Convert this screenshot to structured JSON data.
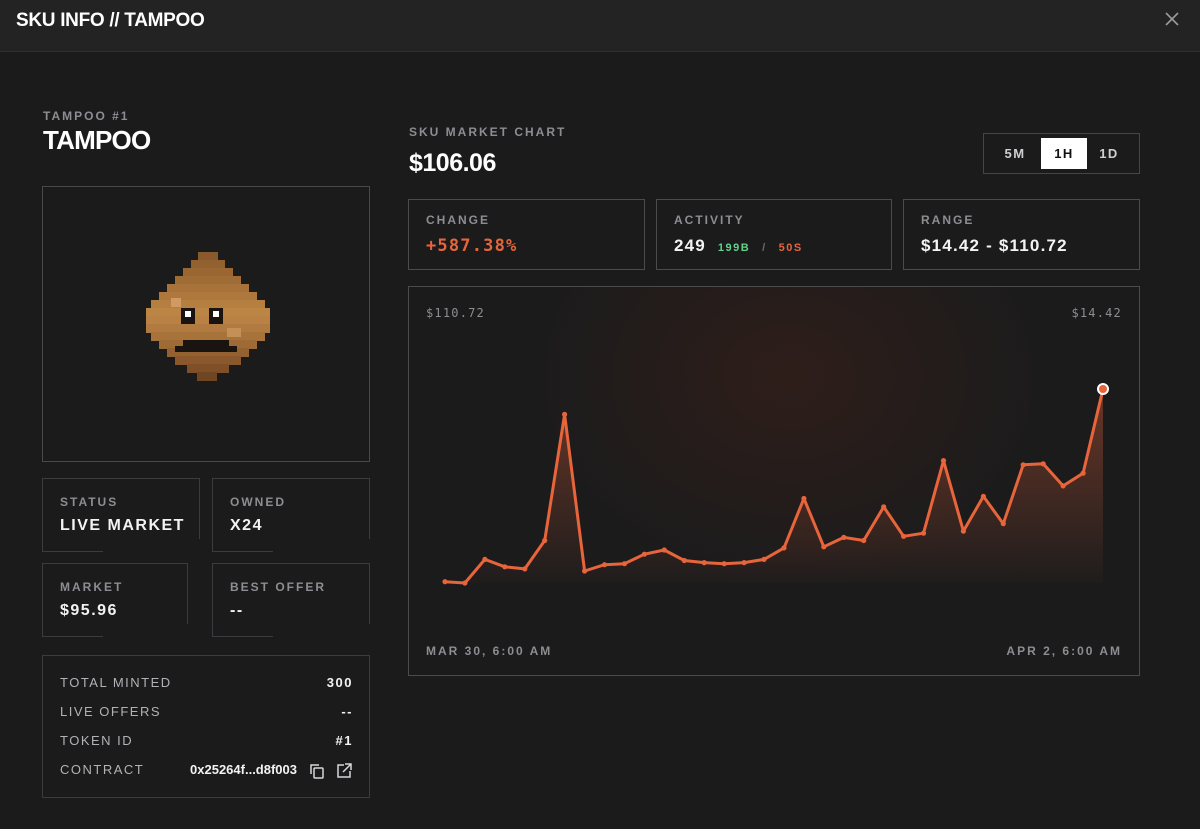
{
  "window": {
    "title": "SKU INFO // TAMPOO",
    "close_icon": "close-icon"
  },
  "item": {
    "subtitle": "TAMPOO #1",
    "name": "TAMPOO"
  },
  "stats": {
    "status": {
      "label": "STATUS",
      "value": "LIVE MARKET"
    },
    "owned": {
      "label": "OWNED",
      "value": "X24"
    },
    "market": {
      "label": "MARKET",
      "value": "$95.96"
    },
    "best_offer": {
      "label": "BEST OFFER",
      "value": "--"
    }
  },
  "details": {
    "total_minted": {
      "label": "TOTAL MINTED",
      "value": "300"
    },
    "live_offers": {
      "label": "LIVE OFFERS",
      "value": "--"
    },
    "token_id": {
      "label": "TOKEN ID",
      "value": "#1"
    },
    "contract": {
      "label": "CONTRACT",
      "value": "0x25264f...d8f003",
      "copy_icon": "copy-icon",
      "link_icon": "external-link-icon"
    }
  },
  "chart_header": {
    "label": "SKU MARKET CHART",
    "price": "$106.06"
  },
  "timeframes": [
    "5M",
    "1H",
    "1D"
  ],
  "active_timeframe": "1H",
  "metrics": {
    "change": {
      "label": "CHANGE",
      "value": "+587.38%"
    },
    "activity": {
      "label": "ACTIVITY",
      "value": "249",
      "buys": "199B",
      "sep": "/",
      "sells": "50S"
    },
    "range": {
      "label": "RANGE",
      "value": "$14.42 - $110.72"
    }
  },
  "colors": {
    "accent": "#e8643a",
    "buy": "#5fd38a",
    "background": "#1b1b1c",
    "border": "#4a4a4f"
  },
  "chart_data": {
    "type": "area",
    "title": "",
    "top_left_label": "$110.72",
    "top_right_label": "$14.42",
    "x_start_label": "MAR 30, 6:00 AM",
    "x_end_label": "APR 2, 6:00 AM",
    "ylim": [
      14.42,
      110.72
    ],
    "grid": false,
    "series": [
      {
        "values": [
          14.4,
          13.8,
          25.0,
          21.5,
          20.5,
          34.0,
          94.0,
          19.5,
          22.5,
          23.0,
          27.5,
          29.5,
          24.5,
          23.5,
          23.0,
          23.5,
          25.0,
          30.5,
          54.0,
          31.0,
          35.5,
          34.0,
          50.0,
          36.0,
          37.5,
          72.0,
          38.5,
          55.0,
          42.0,
          70.0,
          70.5,
          60.0,
          66.0,
          106.06
        ]
      }
    ]
  }
}
